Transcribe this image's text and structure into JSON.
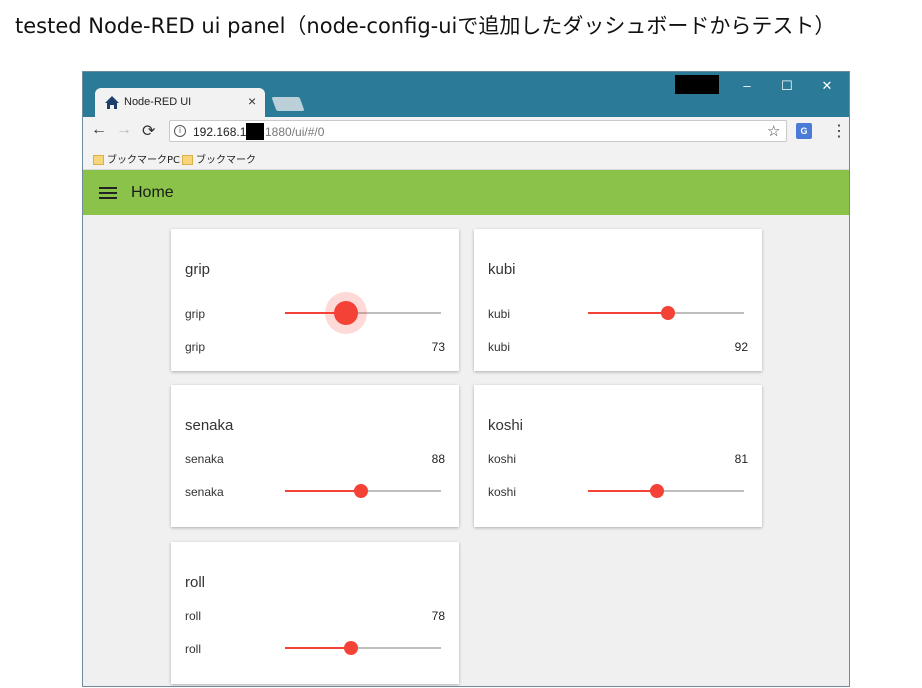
{
  "caption": "tested Node-RED ui panel（node-config-uiで追加したダッシュボードからテスト）",
  "browser": {
    "tab_title": "Node-RED UI",
    "tab_close": "×",
    "url_host": "192.168.1",
    "url_rest": "1880/ui/#/0",
    "window_controls": {
      "minimize": "–",
      "maximize": "☐",
      "close": "✕"
    },
    "nav": {
      "back": "←",
      "forward": "→",
      "reload": "⟳"
    },
    "info_glyph": "i",
    "star_glyph": "☆",
    "translate_glyph": "G",
    "menu_glyph": "⋮",
    "bookmarks": [
      "ブックマークPC",
      "ブックマーク"
    ]
  },
  "app": {
    "title": "Home",
    "accent": "#8bc34a",
    "slider_color": "#f44336"
  },
  "cards": [
    {
      "title": "grip",
      "slider_label": "grip",
      "text_label": "grip",
      "value": "73",
      "slider_fraction": 0.39,
      "active": true
    },
    {
      "title": "kubi",
      "slider_label": "kubi",
      "text_label": "kubi",
      "value": "92",
      "slider_fraction": 0.51,
      "active": false
    },
    {
      "title": "senaka",
      "slider_label": "senaka",
      "text_label": "senaka",
      "value": "88",
      "slider_fraction": 0.49,
      "active": false
    },
    {
      "title": "koshi",
      "slider_label": "koshi",
      "text_label": "koshi",
      "value": "81",
      "slider_fraction": 0.44,
      "active": false
    },
    {
      "title": "roll",
      "slider_label": "roll",
      "text_label": "roll",
      "value": "78",
      "slider_fraction": 0.42,
      "active": false
    }
  ]
}
